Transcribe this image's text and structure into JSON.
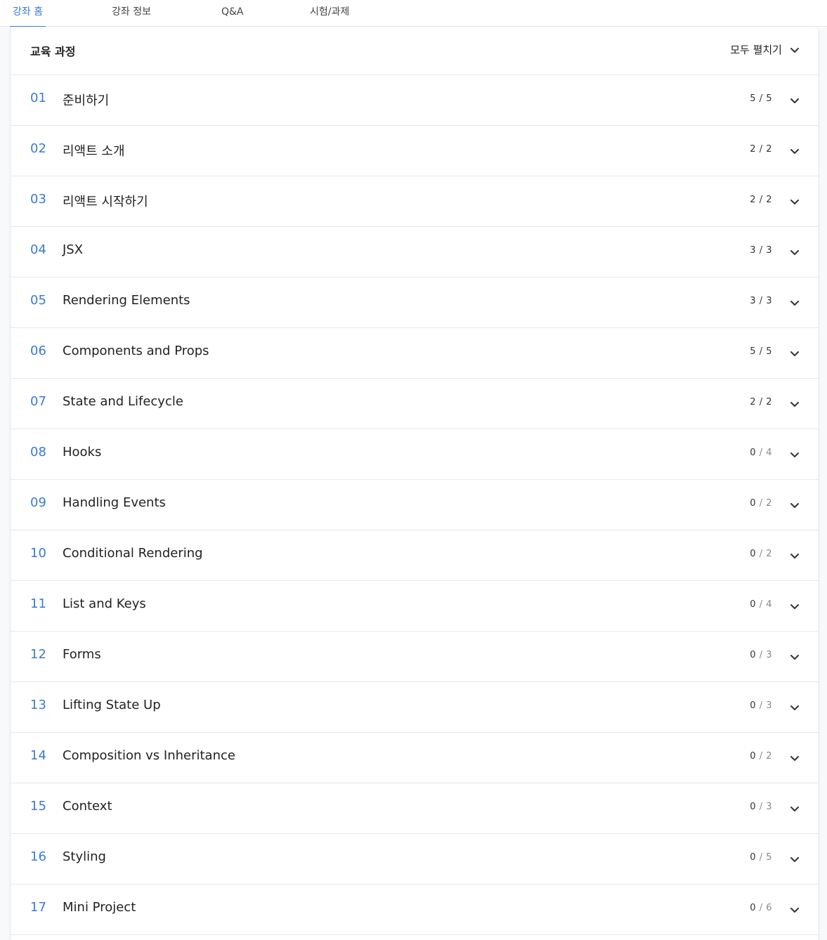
{
  "tabs": [
    {
      "label": "강좌 홈",
      "active": true
    },
    {
      "label": "강좌 정보",
      "active": false
    },
    {
      "label": "Q&A",
      "active": false
    },
    {
      "label": "시험/과제",
      "active": false
    }
  ],
  "curriculum": {
    "title": "교육 과정",
    "expand_all_label": "모두 펼치기",
    "sections": [
      {
        "num": "01",
        "title": "준비하기",
        "done": "5",
        "total": "5"
      },
      {
        "num": "02",
        "title": "리액트 소개",
        "done": "2",
        "total": "2"
      },
      {
        "num": "03",
        "title": "리액트 시작하기",
        "done": "2",
        "total": "2"
      },
      {
        "num": "04",
        "title": "JSX",
        "done": "3",
        "total": "3"
      },
      {
        "num": "05",
        "title": "Rendering Elements",
        "done": "3",
        "total": "3"
      },
      {
        "num": "06",
        "title": "Components and Props",
        "done": "5",
        "total": "5"
      },
      {
        "num": "07",
        "title": "State and Lifecycle",
        "done": "2",
        "total": "2"
      },
      {
        "num": "08",
        "title": "Hooks",
        "done": "0",
        "total": "4"
      },
      {
        "num": "09",
        "title": "Handling Events",
        "done": "0",
        "total": "2"
      },
      {
        "num": "10",
        "title": "Conditional Rendering",
        "done": "0",
        "total": "2"
      },
      {
        "num": "11",
        "title": "List and Keys",
        "done": "0",
        "total": "4"
      },
      {
        "num": "12",
        "title": "Forms",
        "done": "0",
        "total": "3"
      },
      {
        "num": "13",
        "title": "Lifting State Up",
        "done": "0",
        "total": "3"
      },
      {
        "num": "14",
        "title": "Composition vs Inheritance",
        "done": "0",
        "total": "2"
      },
      {
        "num": "15",
        "title": "Context",
        "done": "0",
        "total": "3"
      },
      {
        "num": "16",
        "title": "Styling",
        "done": "0",
        "total": "5"
      },
      {
        "num": "17",
        "title": "Mini Project",
        "done": "0",
        "total": "6"
      }
    ]
  },
  "colors": {
    "accent": "#3a7bd5",
    "border": "#e6e8eb"
  }
}
